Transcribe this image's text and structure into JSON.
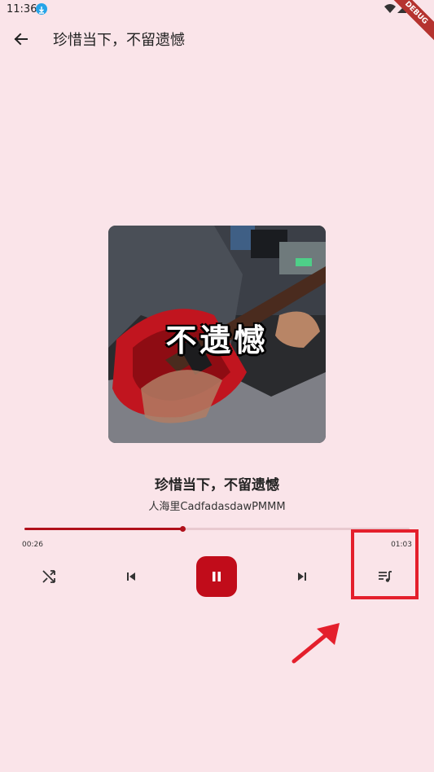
{
  "status_bar": {
    "time": "11:36",
    "debug_label": "DEBUG"
  },
  "app_bar": {
    "title": "珍惜当下，不留遗憾"
  },
  "album": {
    "cover_caption": "不遗憾"
  },
  "song": {
    "title": "珍惜当下，不留遗憾",
    "artist": "人海里CadfadasdawPMMM"
  },
  "progress": {
    "elapsed": "00:26",
    "total": "01:03",
    "fraction": 0.41
  },
  "controls": {
    "shuffle_icon": "shuffle-icon",
    "prev_icon": "skip-previous-icon",
    "play_state": "playing",
    "pause_icon": "pause-icon",
    "next_icon": "skip-next-icon",
    "playlist_icon": "playlist-music-icon"
  },
  "colors": {
    "background": "#fae4e9",
    "accent": "#c10c1a",
    "highlight": "#e41f2c"
  }
}
